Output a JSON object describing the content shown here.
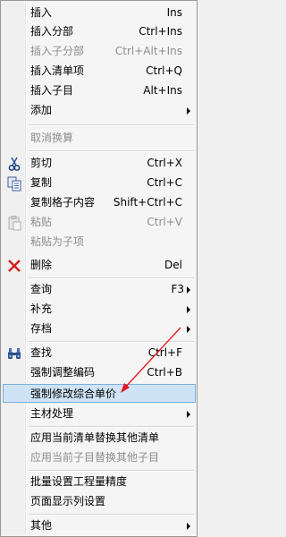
{
  "menu": {
    "insert": {
      "label": "插入",
      "shortcut": "Ins"
    },
    "insert_group": {
      "label": "插入分部",
      "shortcut": "Ctrl+Ins"
    },
    "insert_subgroup": {
      "label": "插入子分部",
      "shortcut": "Ctrl+Alt+Ins"
    },
    "insert_bill": {
      "label": "插入清单项",
      "shortcut": "Ctrl+Q"
    },
    "insert_child": {
      "label": "插入子目",
      "shortcut": "Alt+Ins"
    },
    "add": {
      "label": "添加"
    },
    "cancel_convert": {
      "label": "取消换算"
    },
    "cut": {
      "label": "剪切",
      "shortcut": "Ctrl+X"
    },
    "copy": {
      "label": "复制",
      "shortcut": "Ctrl+C"
    },
    "copy_cell": {
      "label": "复制格子内容",
      "shortcut": "Shift+Ctrl+C"
    },
    "paste": {
      "label": "粘贴",
      "shortcut": "Ctrl+V"
    },
    "paste_child": {
      "label": "粘贴为子项"
    },
    "delete": {
      "label": "删除",
      "shortcut": "Del"
    },
    "query": {
      "label": "查询",
      "shortcut": "F3"
    },
    "supplement": {
      "label": "补充"
    },
    "archive": {
      "label": "存档"
    },
    "find": {
      "label": "查找",
      "shortcut": "Ctrl+F"
    },
    "force_recode": {
      "label": "强制调整编码",
      "shortcut": "Ctrl+B"
    },
    "force_modify_price": {
      "label": "强制修改综合单价"
    },
    "main_material": {
      "label": "主材处理"
    },
    "apply_bill": {
      "label": "应用当前清单替换其他清单"
    },
    "apply_child": {
      "label": "应用当前子目替换其他子目"
    },
    "batch_precision": {
      "label": "批量设置工程量精度"
    },
    "page_columns": {
      "label": "页面显示列设置"
    },
    "other": {
      "label": "其他"
    }
  },
  "colors": {
    "highlight": "#cfe3f7",
    "arrow": "#e8131e"
  }
}
